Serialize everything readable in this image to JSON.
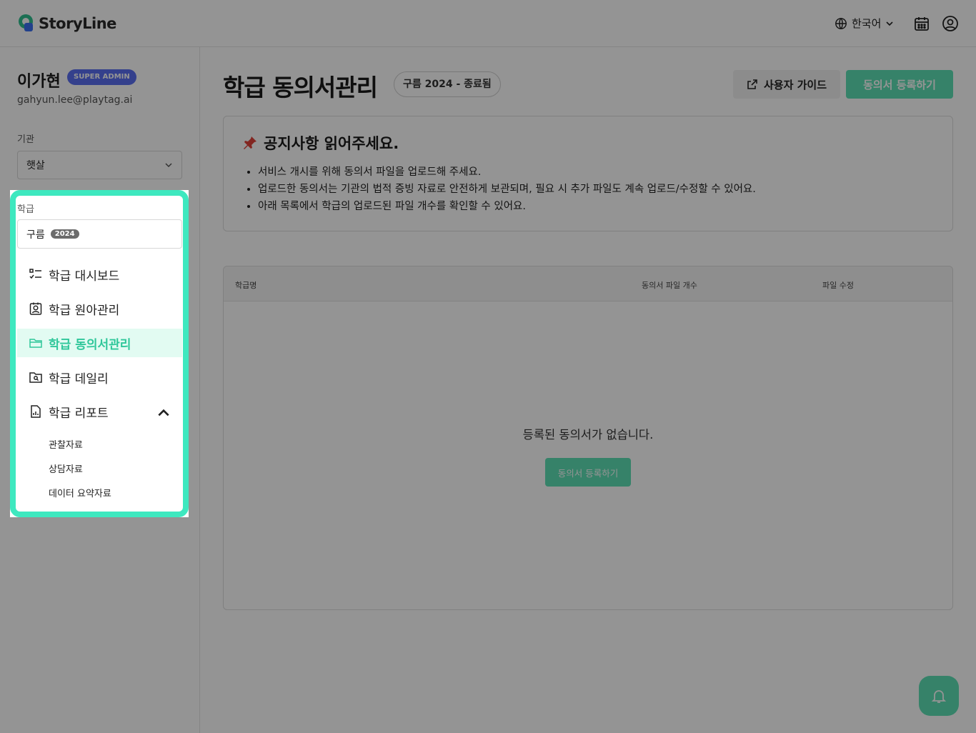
{
  "app": {
    "name": "StoryLine"
  },
  "header": {
    "language": "한국어"
  },
  "user": {
    "name": "이가현",
    "role": "SUPER ADMIN",
    "email": "gahyun.lee@playtag.ai"
  },
  "sidebar": {
    "org_label": "기관",
    "org_value": "햇살",
    "class_label": "학급",
    "class_value": "구름",
    "class_year": "2024",
    "nav": [
      {
        "label": "학급 대시보드",
        "icon": "checklist-icon"
      },
      {
        "label": "학급 원아관리",
        "icon": "contact-card-icon"
      },
      {
        "label": "학급 동의서관리",
        "icon": "folder-icon",
        "active": true
      },
      {
        "label": "학급 데일리",
        "icon": "folder-search-icon"
      },
      {
        "label": "학급 리포트",
        "icon": "report-chart-icon",
        "expanded": true
      }
    ],
    "report_subitems": [
      "관찰자료",
      "상담자료",
      "데이터 요약자료"
    ]
  },
  "main": {
    "title": "학급 동의서관리",
    "term_chip": "구름 2024 - 종료됨",
    "guide_button": "사용자 가이드",
    "register_button": "동의서 등록하기",
    "notice": {
      "title": "공지사항 읽어주세요.",
      "items": [
        "서비스 개시를 위해 동의서 파일을 업로드해 주세요.",
        "업로드한 동의서는 기관의 법적 증빙 자료로 안전하게 보관되며, 필요 시 추가 파일도 계속 업로드/수정할 수 있어요.",
        "아래 목록에서 학급의 업로드된 파일 개수를 확인할 수 있어요."
      ]
    },
    "table": {
      "columns": [
        "학급명",
        "동의서 파일 개수",
        "파일 수정"
      ],
      "empty_text": "등록된 동의서가 없습니다.",
      "empty_button": "동의서 등록하기"
    }
  },
  "colors": {
    "accent": "#3ee8bf",
    "primary_button": "#5ee0b5",
    "badge": "#5b6ff2"
  }
}
